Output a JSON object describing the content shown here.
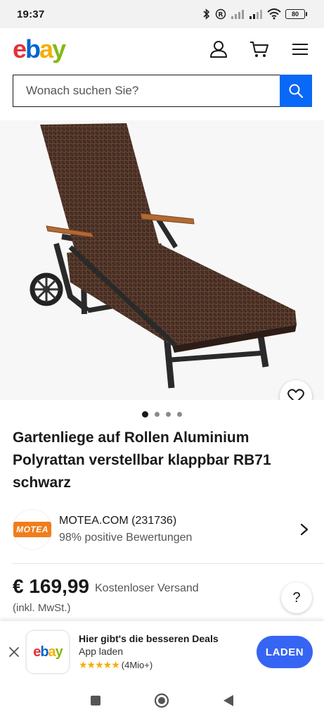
{
  "status_bar": {
    "time": "19:37",
    "battery": "80"
  },
  "header": {
    "logo": {
      "e": "e",
      "b": "b",
      "a": "a",
      "y": "y"
    }
  },
  "search": {
    "placeholder": "Wonach suchen Sie?"
  },
  "gallery": {
    "image_count": 4,
    "active_index": 0
  },
  "product": {
    "title": "Gartenliege auf Rollen Aluminium Polyrattan verstellbar klappbar RB71 schwarz"
  },
  "seller": {
    "logo_text": "MOTEA",
    "name": "MOTEA.COM (231736)",
    "rating": "98% positive Bewertungen"
  },
  "price": {
    "amount": "€ 169,99",
    "shipping": "Kostenloser Versand",
    "vat": "(inkl. MwSt.)",
    "help": "?"
  },
  "app_banner": {
    "title": "Hier gibt's die besseren Deals",
    "subtitle": "App laden",
    "stars": "★★★★★",
    "rating_count": "(4Mio+)",
    "button": "LADEN"
  },
  "colors": {
    "accent_blue": "#0968f6",
    "button_blue": "#3665f3",
    "ebay_red": "#e53238",
    "ebay_blue": "#0064d2",
    "ebay_yellow": "#f5af02",
    "ebay_green": "#86b817"
  },
  "icons": [
    "bluetooth-icon",
    "registered-icon",
    "signal-icon",
    "wifi-icon",
    "battery-icon",
    "user-icon",
    "cart-icon",
    "menu-icon",
    "search-icon",
    "heart-icon",
    "chevron-right-icon",
    "help-icon",
    "close-icon",
    "recent-apps-icon",
    "home-icon",
    "back-icon"
  ]
}
